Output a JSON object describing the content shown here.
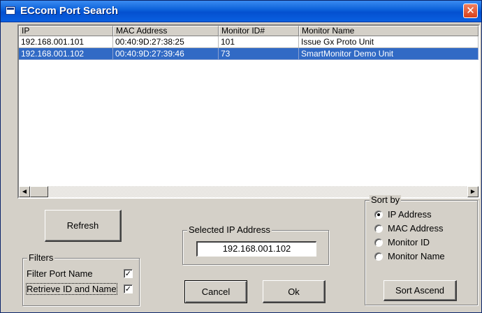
{
  "window": {
    "title": "ECcom Port Search",
    "close_glyph": "✕"
  },
  "list": {
    "columns": [
      "IP",
      "MAC Address",
      "Monitor ID#",
      "Monitor Name"
    ],
    "rows": [
      [
        "192.168.001.101",
        "00:40:9D:27:38:25",
        "101",
        "Issue Gx Proto Unit"
      ],
      [
        "192.168.001.102",
        "00:40:9D:27:39:46",
        "73",
        "SmartMonitor Demo Unit"
      ]
    ],
    "selected_row": 1,
    "scroll_left_glyph": "◀",
    "scroll_right_glyph": "▶"
  },
  "buttons": {
    "refresh": "Refresh",
    "cancel": "Cancel",
    "ok": "Ok",
    "sort": "Sort Ascend"
  },
  "filters": {
    "label": "Filters",
    "filter_port_name": "Filter Port Name",
    "filter_port_name_checked": true,
    "retrieve_id_name": "Retrieve ID and Name",
    "retrieve_id_name_checked": true,
    "check_glyph": "✓"
  },
  "selected_ip": {
    "label": "Selected IP Address",
    "value": "192.168.001.102"
  },
  "sort_by": {
    "label": "Sort by",
    "options": [
      "IP Address",
      "MAC Address",
      "Monitor ID",
      "Monitor Name"
    ],
    "selected": 0
  }
}
